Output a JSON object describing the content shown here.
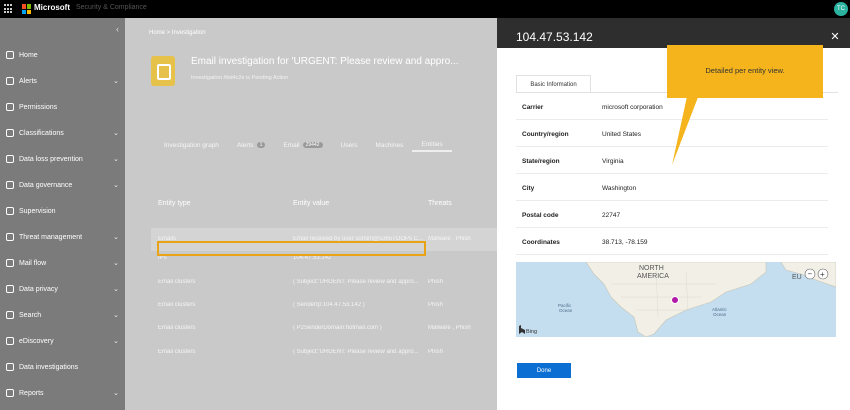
{
  "topbar": {
    "brand": "Microsoft",
    "app_name": "Security & Compliance",
    "avatar": "TC"
  },
  "sidebar": {
    "items": [
      {
        "label": "Home",
        "icon": "home-icon",
        "chevron": false
      },
      {
        "label": "Alerts",
        "icon": "alert-icon",
        "chevron": true
      },
      {
        "label": "Permissions",
        "icon": "people-icon",
        "chevron": false
      },
      {
        "label": "Classifications",
        "icon": "tag-icon",
        "chevron": true
      },
      {
        "label": "Data loss prevention",
        "icon": "shield-icon",
        "chevron": true
      },
      {
        "label": "Data governance",
        "icon": "lock-icon",
        "chevron": true
      },
      {
        "label": "Supervision",
        "icon": "eye-icon",
        "chevron": false
      },
      {
        "label": "Threat management",
        "icon": "bug-icon",
        "chevron": true
      },
      {
        "label": "Mail flow",
        "icon": "mail-icon",
        "chevron": true
      },
      {
        "label": "Data privacy",
        "icon": "privacy-icon",
        "chevron": true
      },
      {
        "label": "Search",
        "icon": "search-icon",
        "chevron": true
      },
      {
        "label": "eDiscovery",
        "icon": "ediscovery-icon",
        "chevron": true
      },
      {
        "label": "Data investigations",
        "icon": "investigation-icon",
        "chevron": false
      },
      {
        "label": "Reports",
        "icon": "report-icon",
        "chevron": true
      }
    ]
  },
  "main": {
    "breadcrumb": "Home  >  Investigation",
    "title": "Email investigation for 'URGENT: Please review and appro...",
    "subtitle": "Investigation #bd4c2e is Pending Action",
    "tabs": [
      {
        "label": "Investigation graph",
        "badge": ""
      },
      {
        "label": "Alerts",
        "badge": "1"
      },
      {
        "label": "Email",
        "badge": "29442"
      },
      {
        "label": "Users",
        "badge": ""
      },
      {
        "label": "Machines",
        "badge": ""
      },
      {
        "label": "Entities",
        "badge": ""
      }
    ],
    "columns": [
      "Entity type",
      "Entity value",
      "Threats"
    ],
    "rows": [
      [
        "Emails",
        "Email received by user somim@s365TOOPs C...",
        "Malware , Phish"
      ],
      [
        "IPs",
        "104.47.53.142",
        ""
      ],
      [
        "Email clusters",
        "( Subject:'URGENT: Please review and appro...",
        "Phish"
      ],
      [
        "Email clusters",
        "( SenderIp:104.47.53.142 )",
        "Phish"
      ],
      [
        "Email clusters",
        "( P2SenderDomain:hotmail.com )",
        "Malware , Phish"
      ],
      [
        "Email clusters",
        "( Subject:'URGENT: Please review and appro...",
        "Phish"
      ]
    ]
  },
  "panel": {
    "title": "104.47.53.142",
    "tab_label": "Basic Information",
    "fields": [
      {
        "key": "Carrier",
        "value": "microsoft corporation"
      },
      {
        "key": "Country/region",
        "value": "United States"
      },
      {
        "key": "State/region",
        "value": "Virginia"
      },
      {
        "key": "City",
        "value": "Washington"
      },
      {
        "key": "Postal code",
        "value": "22747"
      },
      {
        "key": "Coordinates",
        "value": "38.713, -78.159"
      }
    ],
    "map": {
      "north_america": "NORTH\nAMERICA",
      "pacific": "Pacific\nOcean",
      "atlantic": "Atlantic\nOcean",
      "europe": "EU",
      "bing": "Bing",
      "zoom_out": "−",
      "zoom_in": "+"
    },
    "done_label": "Done"
  },
  "callout": {
    "text": "Detailed per entity view."
  },
  "colors": {
    "accent": "#0b6ed3",
    "callout": "#f5b41c",
    "highlight": "#e8a317",
    "marker": "#b01aa7"
  }
}
